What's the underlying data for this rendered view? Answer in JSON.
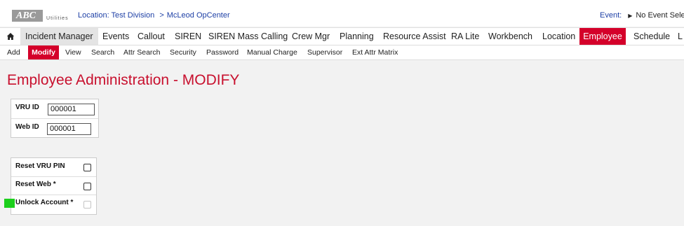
{
  "brand": {
    "name": "ABC",
    "tagline": "Utilities"
  },
  "location": {
    "label": "Location:",
    "division": "Test Division",
    "separator": ">",
    "center": "McLeod OpCenter"
  },
  "event": {
    "label": "Event:",
    "value": "No Event Selec"
  },
  "main_nav": {
    "items": [
      "Incident Manager",
      "Events",
      "Callout",
      "SIREN",
      "SIREN Mass Calling",
      "Crew Mgr",
      "Planning",
      "Resource Assist",
      "RA Lite",
      "Workbench",
      "Location",
      "Employee",
      "Schedule",
      "L"
    ],
    "highlighted": "Incident Manager",
    "active": "Employee"
  },
  "sub_nav": {
    "items": [
      "Add",
      "Modify",
      "View",
      "Search",
      "Attr Search",
      "Security",
      "Password",
      "Manual Charge",
      "Supervisor",
      "Ext Attr Matrix"
    ],
    "active": "Modify"
  },
  "page_title": "Employee Administration - MODIFY",
  "ids": {
    "vru_label": "VRU ID",
    "vru_value": "000001",
    "web_label": "Web ID",
    "web_value": "000001"
  },
  "resets": {
    "reset_vru_pin": {
      "label": "Reset VRU PIN",
      "checked": false
    },
    "reset_web": {
      "label": "Reset Web *",
      "checked": false
    },
    "unlock_account": {
      "label": "Unlock Account *",
      "checked": false,
      "disabled": true
    }
  },
  "colors": {
    "accent": "#d4002a",
    "title": "#c8102e",
    "link": "#1d3fa5",
    "marker": "#1ccf1c"
  }
}
